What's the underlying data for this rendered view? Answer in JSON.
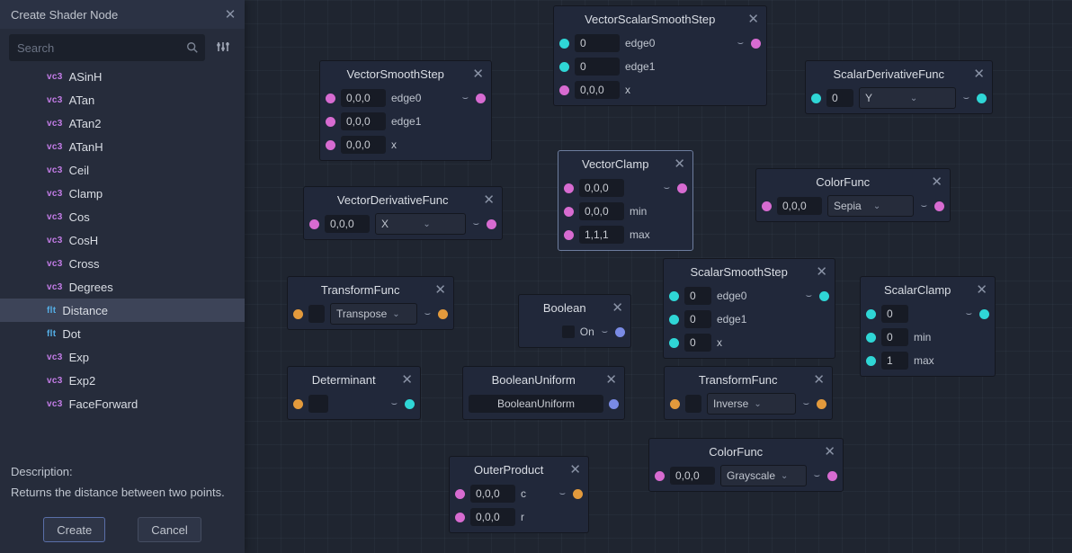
{
  "panel": {
    "title": "Create Shader Node",
    "search_placeholder": "Search",
    "items": [
      {
        "tag": "vc3",
        "label": "ASinH"
      },
      {
        "tag": "vc3",
        "label": "ATan"
      },
      {
        "tag": "vc3",
        "label": "ATan2"
      },
      {
        "tag": "vc3",
        "label": "ATanH"
      },
      {
        "tag": "vc3",
        "label": "Ceil"
      },
      {
        "tag": "vc3",
        "label": "Clamp"
      },
      {
        "tag": "vc3",
        "label": "Cos"
      },
      {
        "tag": "vc3",
        "label": "CosH"
      },
      {
        "tag": "vc3",
        "label": "Cross"
      },
      {
        "tag": "vc3",
        "label": "Degrees"
      },
      {
        "tag": "flt",
        "label": "Distance",
        "selected": true
      },
      {
        "tag": "flt",
        "label": "Dot"
      },
      {
        "tag": "vc3",
        "label": "Exp"
      },
      {
        "tag": "vc3",
        "label": "Exp2"
      },
      {
        "tag": "vc3",
        "label": "FaceForward"
      }
    ],
    "desc_head": "Description:",
    "desc_text": "Returns the distance between two points.",
    "btn_create": "Create",
    "btn_cancel": "Cancel"
  },
  "nodes": {
    "vss": {
      "title": "VectorScalarSmoothStep",
      "r1_v": "0",
      "r1_l": "edge0",
      "r2_v": "0",
      "r2_l": "edge1",
      "r3_v": "0,0,0",
      "r3_l": "x"
    },
    "sdf": {
      "title": "ScalarDerivativeFunc",
      "r1_v": "0",
      "dd": "Y"
    },
    "vsm": {
      "title": "VectorSmoothStep",
      "r1_v": "0,0,0",
      "r1_l": "edge0",
      "r2_v": "0,0,0",
      "r2_l": "edge1",
      "r3_v": "0,0,0",
      "r3_l": "x"
    },
    "vdf": {
      "title": "VectorDerivativeFunc",
      "r1_v": "0,0,0",
      "dd": "X"
    },
    "vc": {
      "title": "VectorClamp",
      "r1_v": "0,0,0",
      "r2_v": "0,0,0",
      "r2_l": "min",
      "r3_v": "1,1,1",
      "r3_l": "max"
    },
    "cf1": {
      "title": "ColorFunc",
      "r1_v": "0,0,0",
      "dd": "Sepia"
    },
    "tf1": {
      "title": "TransformFunc",
      "dd": "Transpose"
    },
    "sss": {
      "title": "ScalarSmoothStep",
      "r1_v": "0",
      "r1_l": "edge0",
      "r2_v": "0",
      "r2_l": "edge1",
      "r3_v": "0",
      "r3_l": "x"
    },
    "sc": {
      "title": "ScalarClamp",
      "r1_v": "0",
      "r2_v": "0",
      "r2_l": "min",
      "r3_v": "1",
      "r3_l": "max"
    },
    "bool": {
      "title": "Boolean",
      "r1_l": "On"
    },
    "det": {
      "title": "Determinant"
    },
    "bu": {
      "title": "BooleanUniform",
      "r1_l": "BooleanUniform"
    },
    "tf2": {
      "title": "TransformFunc",
      "dd": "Inverse"
    },
    "cf2": {
      "title": "ColorFunc",
      "r1_v": "0,0,0",
      "dd": "Grayscale"
    },
    "op": {
      "title": "OuterProduct",
      "r1_v": "0,0,0",
      "r1_l": "c",
      "r2_v": "0,0,0",
      "r2_l": "r"
    }
  }
}
